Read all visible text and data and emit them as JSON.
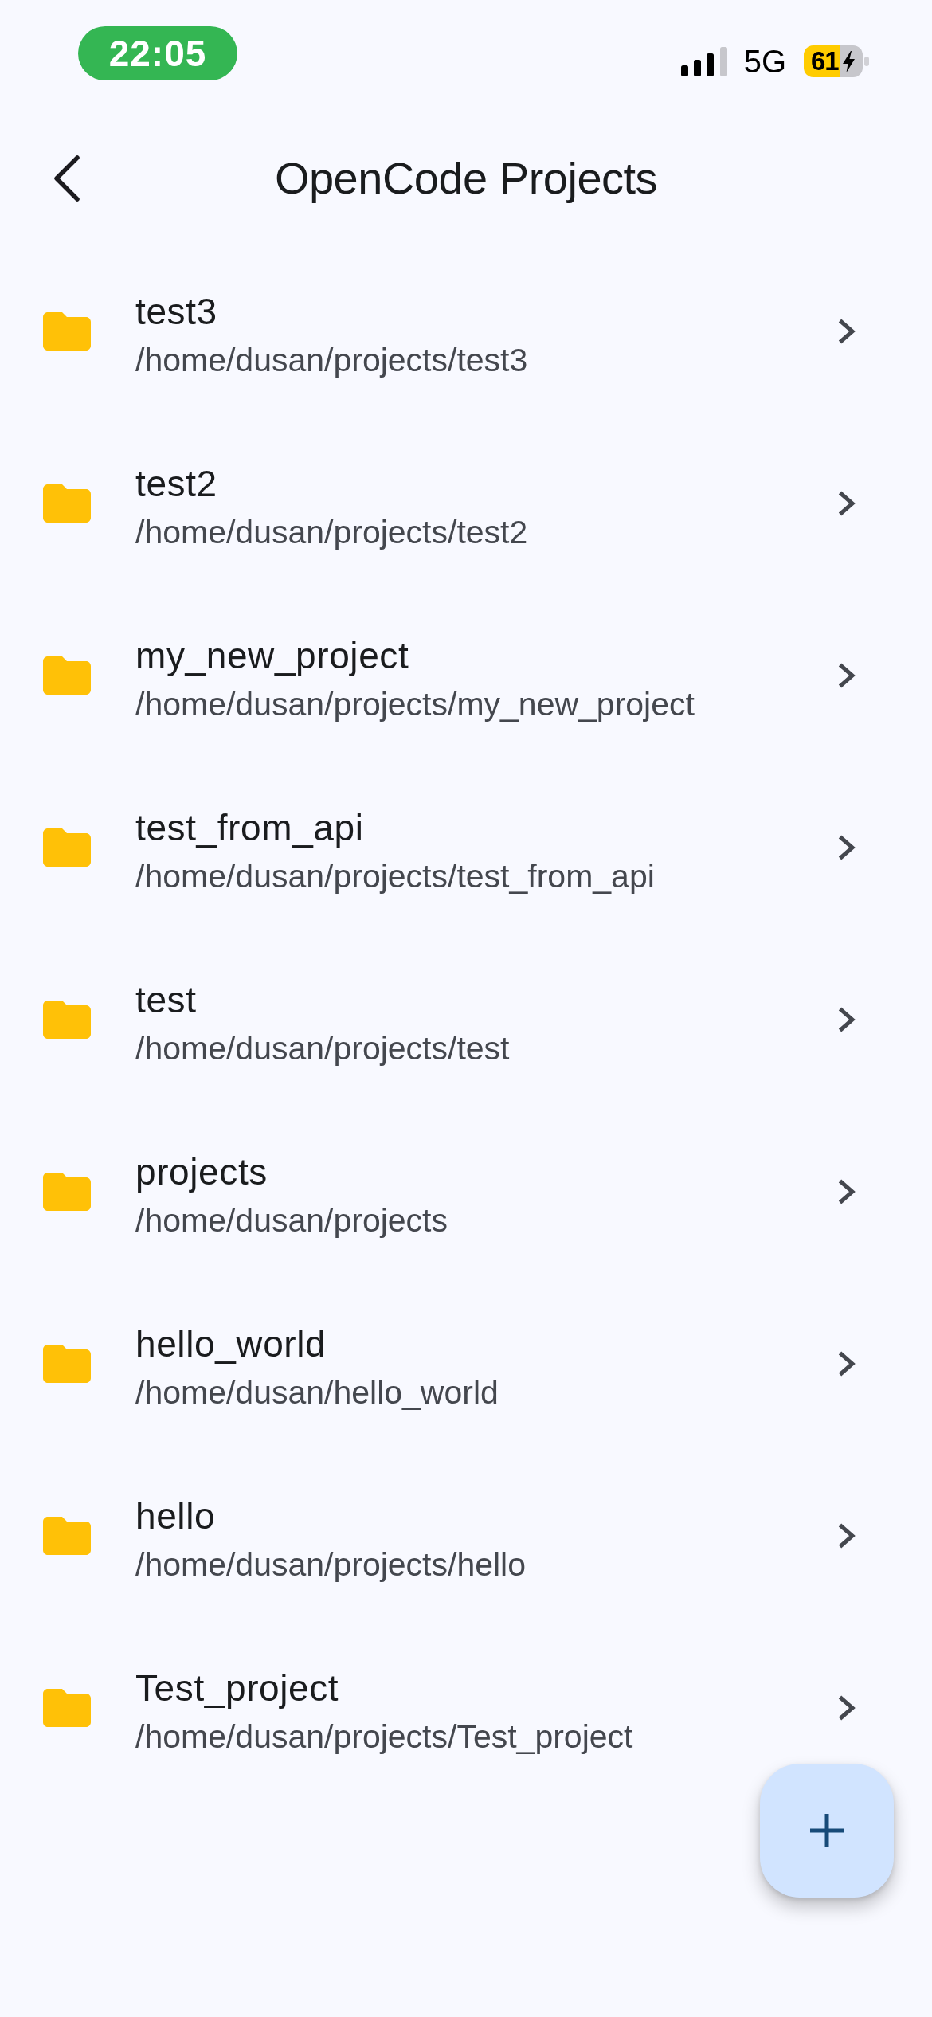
{
  "status_bar": {
    "time": "22:05",
    "network": "5G",
    "battery": "61",
    "charging": true
  },
  "app_bar": {
    "title": "OpenCode Projects"
  },
  "projects": [
    {
      "name": "test3",
      "path": "/home/dusan/projects/test3"
    },
    {
      "name": "test2",
      "path": "/home/dusan/projects/test2"
    },
    {
      "name": "my_new_project",
      "path": "/home/dusan/projects/my_new_project"
    },
    {
      "name": "test_from_api",
      "path": "/home/dusan/projects/test_from_api"
    },
    {
      "name": "test",
      "path": "/home/dusan/projects/test"
    },
    {
      "name": "projects",
      "path": "/home/dusan/projects"
    },
    {
      "name": "hello_world",
      "path": "/home/dusan/hello_world"
    },
    {
      "name": "hello",
      "path": "/home/dusan/projects/hello"
    },
    {
      "name": "Test_project",
      "path": "/home/dusan/projects/Test_project"
    }
  ]
}
